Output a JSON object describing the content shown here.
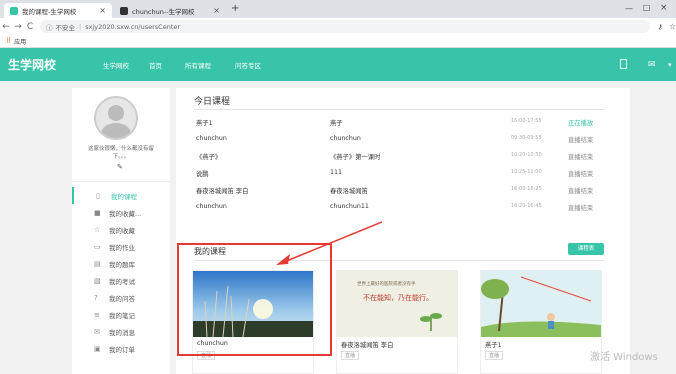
{
  "browser": {
    "tabs": [
      {
        "title": "我的课程-生学网校",
        "active": true
      },
      {
        "title": "chunchun--生学网校",
        "active": false
      }
    ],
    "new_tab": "+",
    "nav": {
      "back": "←",
      "forward": "→",
      "reload": "C"
    },
    "security": "不安全",
    "url": "sxjy2020.sxw.cn/usersCenter",
    "bookmarks_label": "应用"
  },
  "site": {
    "logo": "生学网校",
    "nav": [
      "生学网校",
      "首页",
      "所有课程",
      "问答专区"
    ],
    "accent": "#37c4a8"
  },
  "sidebar": {
    "bio": "这家伙很懒，什么都没有留下。。。",
    "items": [
      {
        "label": "我的课程",
        "icon": "book-icon",
        "glyph": "▯"
      },
      {
        "label": "我的收藏...",
        "icon": "folder-icon",
        "glyph": "■"
      },
      {
        "label": "我的收藏",
        "icon": "star-icon",
        "glyph": "☆"
      },
      {
        "label": "我的作业",
        "icon": "homework-icon",
        "glyph": "▭"
      },
      {
        "label": "我的题库",
        "icon": "question-bank-icon",
        "glyph": "▤"
      },
      {
        "label": "我的考试",
        "icon": "exam-icon",
        "glyph": "▧"
      },
      {
        "label": "我的问答",
        "icon": "question-icon",
        "glyph": "?"
      },
      {
        "label": "我的笔记",
        "icon": "note-icon",
        "glyph": "≡"
      },
      {
        "label": "我的消息",
        "icon": "mail-icon",
        "glyph": "✉"
      },
      {
        "label": "我的订单",
        "icon": "order-icon",
        "glyph": "▣"
      }
    ]
  },
  "today": {
    "title": "今日课程",
    "rows": [
      {
        "course": "燕子1",
        "lesson": "燕子",
        "time": "16:00-17:55",
        "status": "正在播放"
      },
      {
        "course": "chunchun",
        "lesson": "chunchun",
        "time": "09:30-09:55",
        "status": "直播结束"
      },
      {
        "course": "《燕子》",
        "lesson": "《燕子》第一课时",
        "time": "10:20-10:50",
        "status": "直播结束"
      },
      {
        "course": "说鹏",
        "lesson": "111",
        "time": "10:25-11:00",
        "status": "直播结束"
      },
      {
        "course": "春夜洛城闻笛 李白",
        "lesson": "春夜洛城闻笛",
        "time": "16:00-16:25",
        "status": "直播结束"
      },
      {
        "course": "chunchun",
        "lesson": "chunchun11",
        "time": "16:20-16:45",
        "status": "直播结束"
      }
    ]
  },
  "my_courses": {
    "title": "我的课程",
    "button": "课程表",
    "cards": [
      {
        "title": "chunchun",
        "badge": "直播"
      },
      {
        "title": "春夜洛城闻笛 李白",
        "badge": "直播"
      },
      {
        "title": "燕子1",
        "badge": "直播"
      }
    ],
    "card2_text_a": "世界上最好的医院或者没有手",
    "card2_text_b": "不在能知，乃在能行。"
  },
  "watermark": "激活 Windows"
}
